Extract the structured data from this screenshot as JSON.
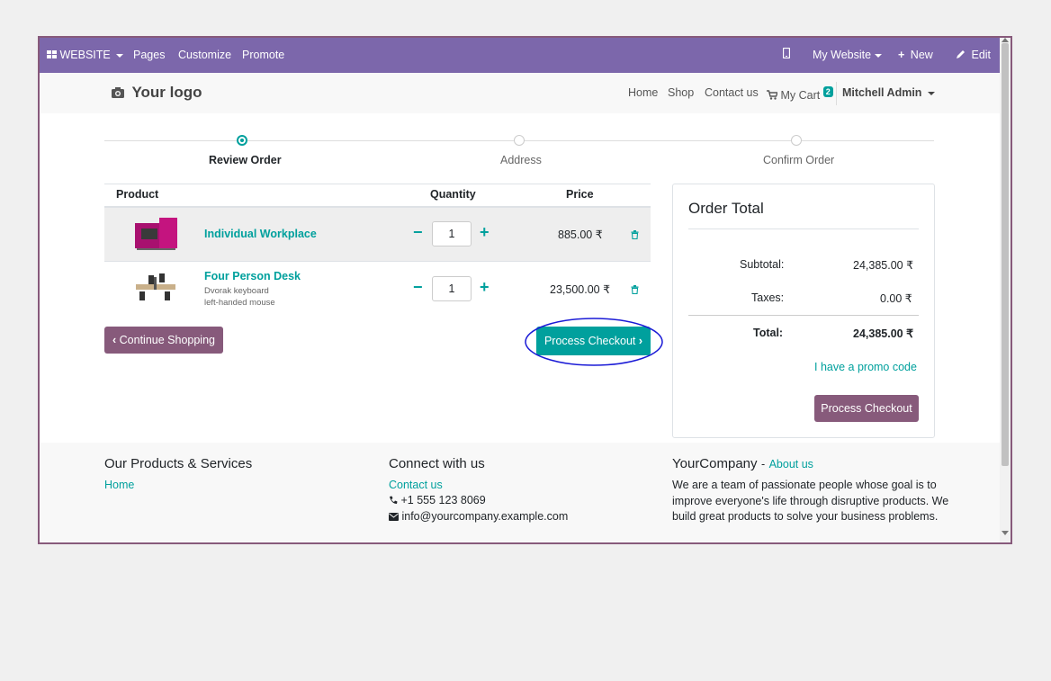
{
  "topbar": {
    "website": "WEBSITE",
    "pages": "Pages",
    "customize": "Customize",
    "promote": "Promote",
    "my_website": "My Website",
    "new": "New",
    "edit": "Edit"
  },
  "header": {
    "logo": "Your logo",
    "nav": {
      "home": "Home",
      "shop": "Shop",
      "contact": "Contact us",
      "cart": "My Cart",
      "cart_count": "2"
    },
    "user": "Mitchell Admin"
  },
  "steps": {
    "review": "Review Order",
    "address": "Address",
    "confirm": "Confirm Order"
  },
  "cart": {
    "headers": {
      "product": "Product",
      "quantity": "Quantity",
      "price": "Price"
    },
    "items": [
      {
        "name": "Individual Workplace",
        "desc": [],
        "qty": "1",
        "price": "885.00 ₹"
      },
      {
        "name": "Four Person Desk",
        "desc": [
          "Dvorak keyboard",
          "left-handed mouse"
        ],
        "qty": "1",
        "price": "23,500.00 ₹"
      }
    ],
    "continue": "Continue Shopping",
    "checkout": "Process Checkout"
  },
  "summary": {
    "title": "Order Total",
    "subtotal_label": "Subtotal:",
    "subtotal": "24,385.00 ₹",
    "taxes_label": "Taxes:",
    "taxes": "0.00 ₹",
    "total_label": "Total:",
    "total": "24,385.00 ₹",
    "promo": "I have a promo code",
    "checkout": "Process Checkout"
  },
  "footer": {
    "col1_title": "Our Products & Services",
    "col1_link": "Home",
    "col2_title": "Connect with us",
    "col2_contact": "Contact us",
    "col2_phone": "+1 555 123 8069",
    "col2_email": "info@yourcompany.example.com",
    "col3_company": "YourCompany",
    "col3_dash": "-",
    "col3_about": "About us",
    "col3_line1": "We are a team of passionate people whose goal is to",
    "col3_line2": "improve everyone's life through disruptive products. We",
    "col3_line3": "build great products to solve your business problems."
  }
}
